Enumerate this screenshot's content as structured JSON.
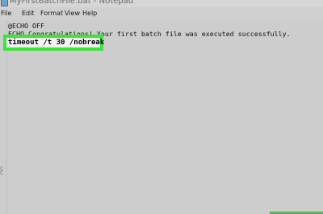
{
  "window": {
    "title": "MyFirstBatchFile.bat - Notepad",
    "icon": "notepad-icon"
  },
  "menu": {
    "items": [
      "File",
      "Edit",
      "Format",
      "View",
      "Help"
    ]
  },
  "editor": {
    "lines": [
      "@ECHO OFF",
      "ECHO Congratulations! Your first batch file was executed successfully."
    ],
    "highlighted_line": "timeout /t 30 /nobreak",
    "left_marks": [
      "C",
      "C"
    ]
  },
  "colors": {
    "highlight": "#39e539",
    "corner_accent": "#58b75a"
  }
}
